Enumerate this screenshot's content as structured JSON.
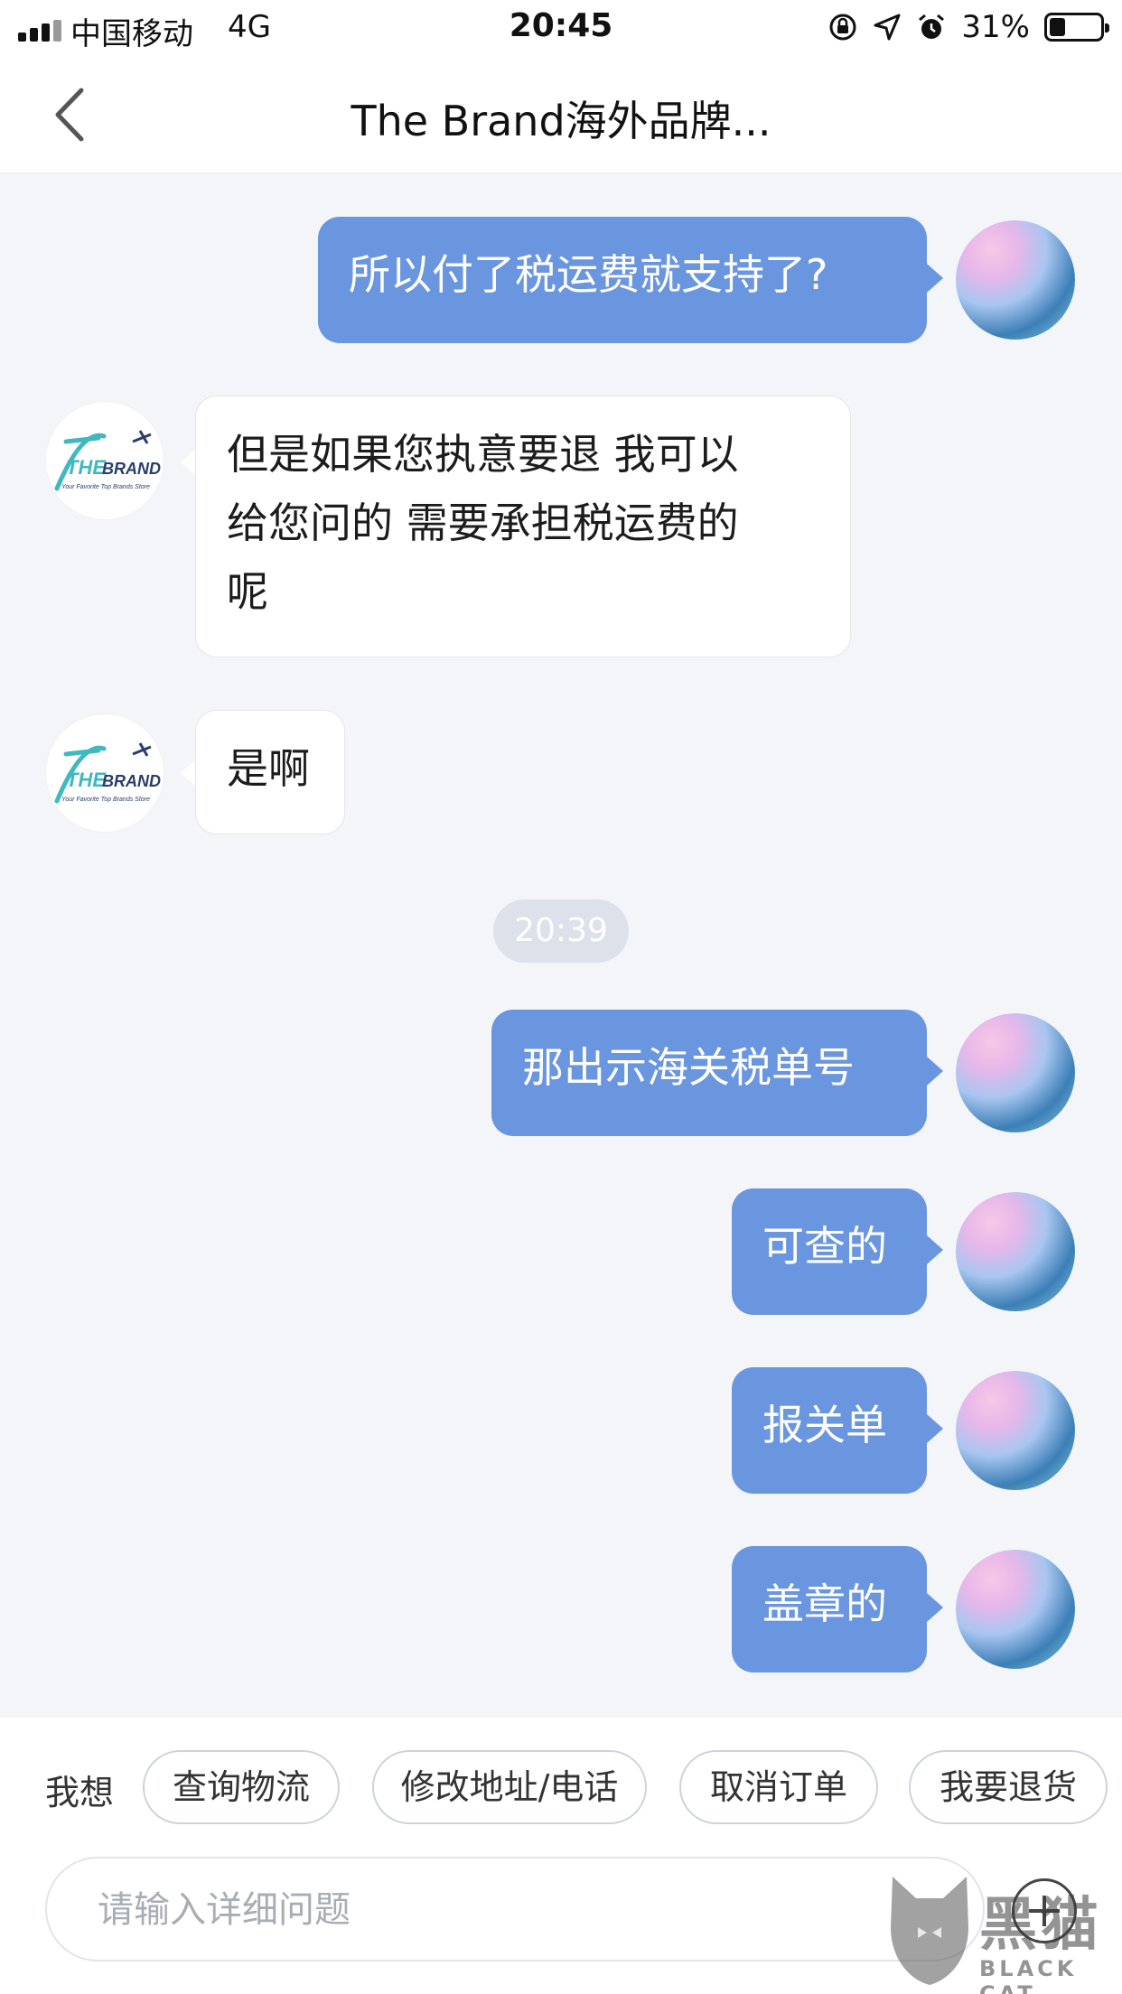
{
  "status_bar": {
    "carrier": "中国移动",
    "network": "4G",
    "time": "20:45",
    "battery_percent": "31%",
    "battery_level": 0.31,
    "icons": [
      "signal-icon",
      "orientation-lock-icon",
      "location-icon",
      "alarm-icon",
      "battery-icon"
    ]
  },
  "nav": {
    "title": "The Brand海外品牌...",
    "back_icon": "chevron-left-icon"
  },
  "messages": [
    {
      "from": "me",
      "text": "所以付了税运费就支持了?"
    },
    {
      "from": "shop",
      "lines": [
        "但是如果您执意要退 我可以",
        "给您问的 需要承担税运费的",
        "呢"
      ]
    },
    {
      "from": "shop",
      "text": "是啊"
    },
    {
      "from": "system",
      "text": "20:39"
    },
    {
      "from": "me",
      "text": "那出示海关税单号"
    },
    {
      "from": "me",
      "text": "可查的"
    },
    {
      "from": "me",
      "text": "报关单"
    },
    {
      "from": "me",
      "text": "盖章的"
    }
  ],
  "shop_avatar": {
    "logo_text": "THEBRAND",
    "tagline": "Your Favorite Top Brands Store",
    "colors": {
      "teal": "#3fb8c0",
      "navy": "#2a3d6b"
    }
  },
  "quick_replies": {
    "label": "我想",
    "chips": [
      "查询物流",
      "修改地址/电话",
      "取消订单",
      "我要退货"
    ]
  },
  "input": {
    "placeholder": "请输入详细问题",
    "value": ""
  },
  "watermark": {
    "text": "黑猫",
    "sub": "BLACK CAT"
  },
  "colors": {
    "outgoing_bubble": "#6a96e0",
    "incoming_bubble": "#ffffff",
    "background": "#f3f5f9"
  }
}
